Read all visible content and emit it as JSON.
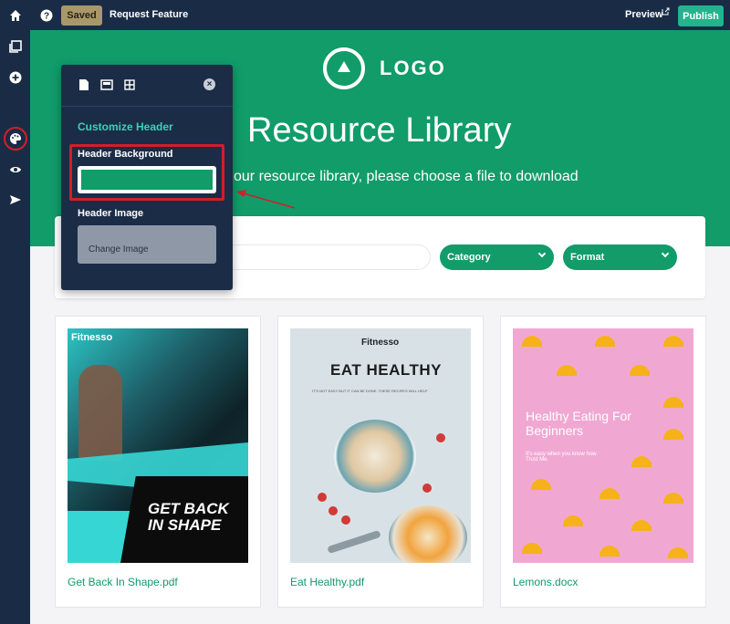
{
  "topbar": {
    "saved": "Saved",
    "request_feature": "Request Feature",
    "preview": "Preview",
    "publish": "Publish"
  },
  "hero": {
    "logo_text": "LOGO",
    "title": "Resource Library",
    "subtitle": "our resource library, please choose a file to download",
    "background_color": "#119c6a"
  },
  "filters": {
    "category": "Category",
    "format": "Format"
  },
  "cards": [
    {
      "title": "Get Back In Shape.pdf",
      "cover_brand": "Fitnesso",
      "cover_slogan": "GET BACK IN SHAPE"
    },
    {
      "title": "Eat Healthy.pdf",
      "cover_brand": "Fitnesso",
      "cover_title": "EAT HEALTHY",
      "cover_tag": "IT'S NOT EASY BUT IT CAN BE DONE. THESE RECIPES WILL HELP"
    },
    {
      "title": "Lemons.docx",
      "cover_text": "Healthy Eating For Beginners",
      "cover_small": "It's easy when you know how. Trust Me."
    }
  ],
  "popover": {
    "heading": "Customize Header",
    "bg_label": "Header Background",
    "bg_value": "#119c6a",
    "image_label": "Header Image",
    "change_image": "Change Image",
    "close": "×"
  },
  "colors": {
    "accent": "#119c6a",
    "dark": "#1a2c45",
    "highlight": "#d11f2a",
    "publish": "#24b38c"
  },
  "icons": {
    "rail": [
      "home-icon",
      "pages-icon",
      "add-icon",
      "palette-icon",
      "eye-icon",
      "send-icon"
    ]
  }
}
